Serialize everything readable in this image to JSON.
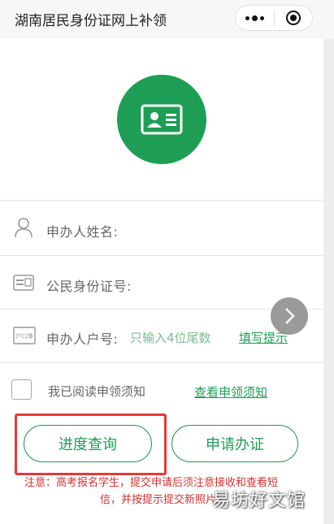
{
  "header": {
    "title": "湖南居民身份证网上补领"
  },
  "form": {
    "name_label": "申办人姓名:",
    "id_label": "公民身份证号:",
    "hukou_label": "申办人户号:",
    "hukou_placeholder": "只输入4位尾数",
    "hukou_tip_link": "填写提示",
    "hukou_badge": "户口簿"
  },
  "agreement": {
    "text": "我已阅读申领须知",
    "link": "查看申领须知"
  },
  "buttons": {
    "progress": "进度查询",
    "apply": "申请办证"
  },
  "notice": {
    "line1": "注意：高考报名学生，提交申请后须注意接收和查看短",
    "line2": "信，并按提示提交新照片。"
  },
  "watermark": "易坊好文馆",
  "colors": {
    "brand_green": "#1e9e54",
    "hint_green": "#7fb992",
    "notice_red": "#d32f2f",
    "highlight_red": "#e53935"
  },
  "icons": {
    "header": [
      "more-icon",
      "close-icon"
    ],
    "logo": "id-card-icon",
    "rows": [
      "person-icon",
      "id-card-outline-icon",
      "household-register-icon"
    ],
    "float": "chevron-right-icon"
  }
}
